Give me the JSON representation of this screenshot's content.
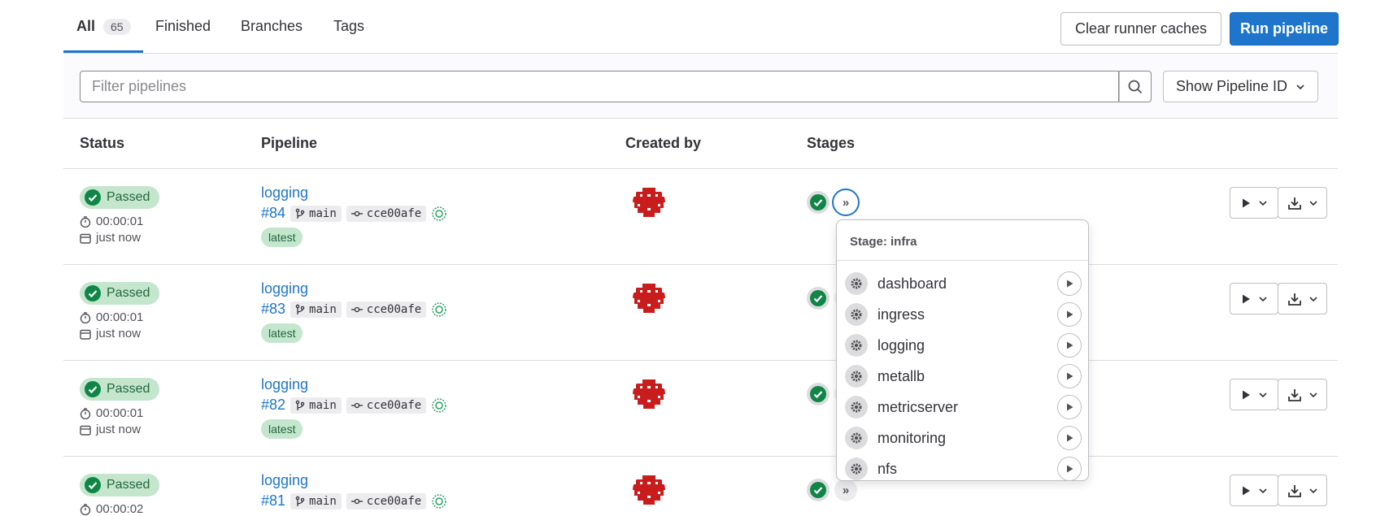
{
  "tabs": [
    {
      "label": "All",
      "count": "65"
    },
    {
      "label": "Finished"
    },
    {
      "label": "Branches"
    },
    {
      "label": "Tags"
    }
  ],
  "header_buttons": {
    "clear_caches": "Clear runner caches",
    "run_pipeline": "Run pipeline"
  },
  "filter": {
    "placeholder": "Filter pipelines",
    "dropdown_label": "Show Pipeline ID"
  },
  "table": {
    "columns": [
      "Status",
      "Pipeline",
      "Created by",
      "Stages"
    ]
  },
  "rows": [
    {
      "status": "Passed",
      "duration": "00:00:01",
      "finished": "just now",
      "title": "logging",
      "id": "#84",
      "branch": "main",
      "commit": "cce00afe",
      "tag": "latest"
    },
    {
      "status": "Passed",
      "duration": "00:00:01",
      "finished": "just now",
      "title": "logging",
      "id": "#83",
      "branch": "main",
      "commit": "cce00afe",
      "tag": "latest"
    },
    {
      "status": "Passed",
      "duration": "00:00:01",
      "finished": "just now",
      "title": "logging",
      "id": "#82",
      "branch": "main",
      "commit": "cce00afe",
      "tag": "latest"
    },
    {
      "status": "Passed",
      "duration": "00:00:02",
      "finished": "",
      "title": "logging",
      "id": "#81",
      "branch": "main",
      "commit": "cce00afe",
      "tag": ""
    }
  ],
  "stage_popover": {
    "title": "Stage: infra",
    "jobs": [
      "dashboard",
      "ingress",
      "logging",
      "metallb",
      "metricserver",
      "monitoring",
      "nfs"
    ]
  },
  "colors": {
    "accent": "#1f75cb",
    "success": "#108548",
    "success_bg": "#c3e6cd"
  },
  "icons": [
    "search-icon",
    "chevron-down-icon",
    "status-success-icon",
    "timer-icon",
    "calendar-icon",
    "branch-icon",
    "commit-icon",
    "auto-devops-icon",
    "expand-stages-icon",
    "gear-icon",
    "play-icon",
    "download-icon"
  ]
}
